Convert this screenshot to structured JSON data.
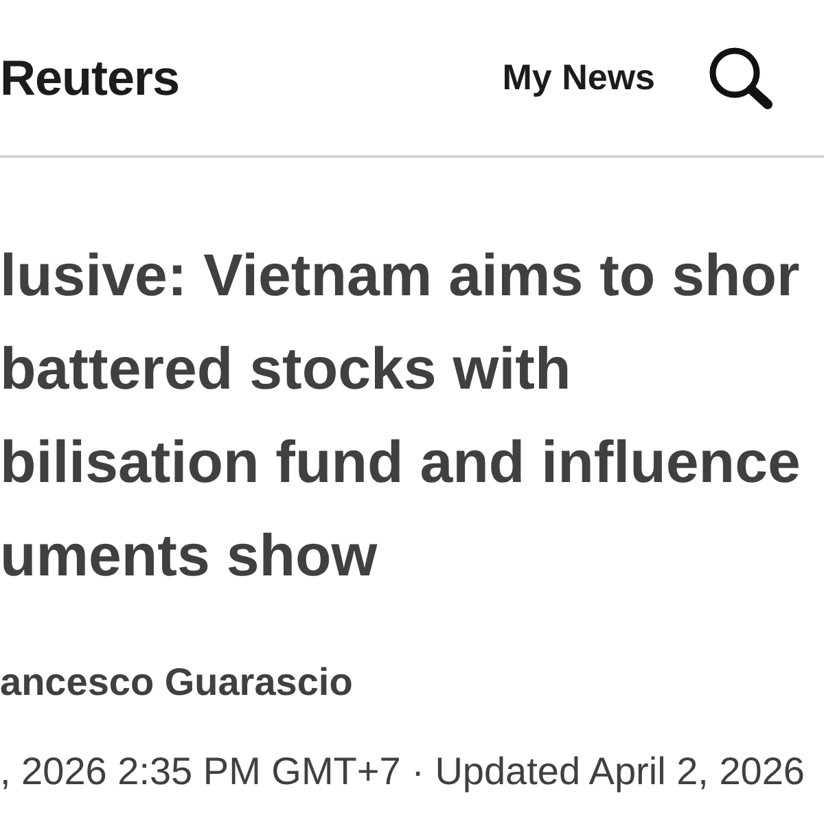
{
  "header": {
    "logo": "Reuters",
    "nav_link": "My News"
  },
  "article": {
    "headline": "lusive: Vietnam aims to shor\nbattered stocks with\nbilisation fund and influence\numents show",
    "byline": "ancesco Guarascio",
    "dateline": ", 2026 2:35 PM GMT+7 · Updated April 2, 2026"
  }
}
